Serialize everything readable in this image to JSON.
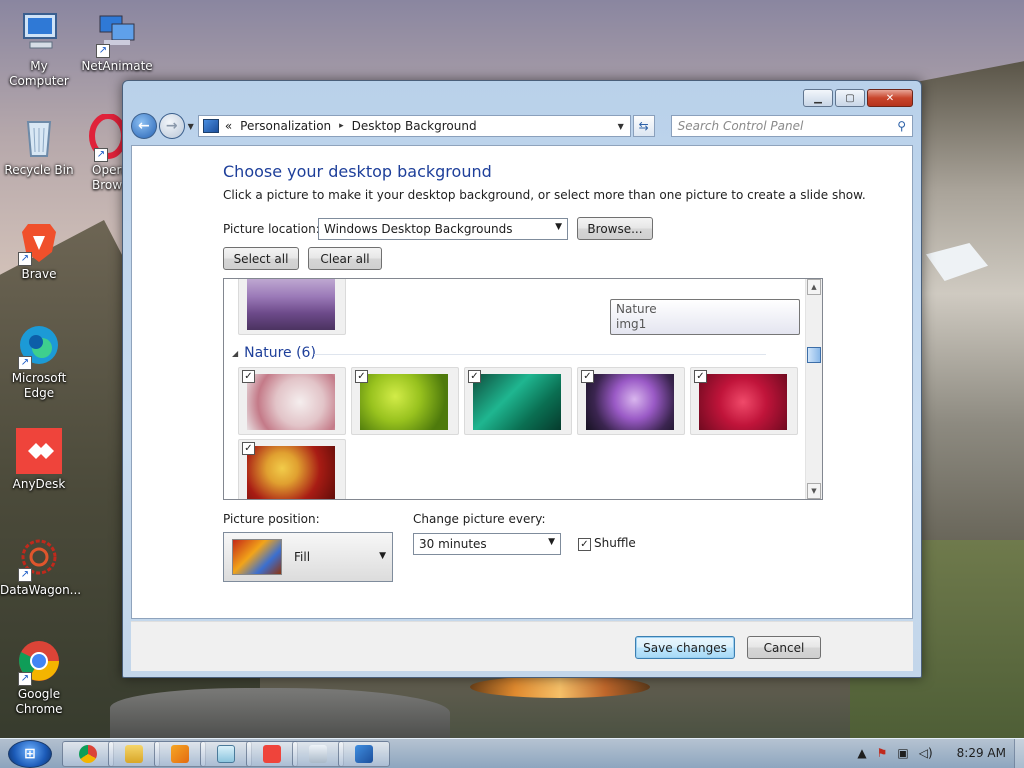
{
  "desktop": {
    "icons": [
      {
        "label": "My Computer",
        "icon": "computer-icon"
      },
      {
        "label": "NetAnimate",
        "icon": "network-computers-icon"
      },
      {
        "label": "Recycle Bin",
        "icon": "recycle-bin-icon"
      },
      {
        "label": "Opera Brow",
        "icon": "opera-icon"
      },
      {
        "label": "Brave",
        "icon": "brave-icon"
      },
      {
        "label": "Microsoft Edge",
        "icon": "edge-icon"
      },
      {
        "label": "AnyDesk",
        "icon": "anydesk-icon"
      },
      {
        "label": "DataWagon...",
        "icon": "datawagon-icon"
      },
      {
        "label": "Google Chrome",
        "icon": "chrome-icon"
      }
    ]
  },
  "window": {
    "caption": {
      "minimize": "▁",
      "maximize": "▢",
      "close": "✕"
    },
    "breadcrumb": {
      "prefix": "«",
      "items": [
        "Personalization",
        "Desktop Background"
      ],
      "separator": "▸"
    },
    "search": {
      "placeholder": "Search Control Panel"
    },
    "heading": "Choose your desktop background",
    "subtitle": "Click a picture to make it your desktop background, or select more than one picture to create a slide show.",
    "picture_location": {
      "label": "Picture location:",
      "value": "Windows Desktop Backgrounds"
    },
    "browse_label": "Browse...",
    "select_all_label": "Select all",
    "clear_all_label": "Clear all",
    "tooltip": {
      "line1": "Nature",
      "line2": "img1"
    },
    "group": {
      "title": "Nature (6)",
      "checked_count": 6
    },
    "picture_position": {
      "label": "Picture position:",
      "value": "Fill"
    },
    "change_every": {
      "label": "Change picture every:",
      "value": "30 minutes"
    },
    "shuffle": {
      "label": "Shuffle",
      "checked": true
    },
    "save_label": "Save changes",
    "cancel_label": "Cancel",
    "checkmark": "✓"
  },
  "taskbar": {
    "apps": [
      "chrome-icon",
      "explorer-icon",
      "media-player-icon",
      "notepad-icon",
      "anydesk-icon",
      "network-icon",
      "remote-desktop-icon"
    ],
    "clock": "8:29 AM"
  },
  "colors": {
    "heading": "#1e3f9a",
    "accent": "#3c7fb1"
  }
}
